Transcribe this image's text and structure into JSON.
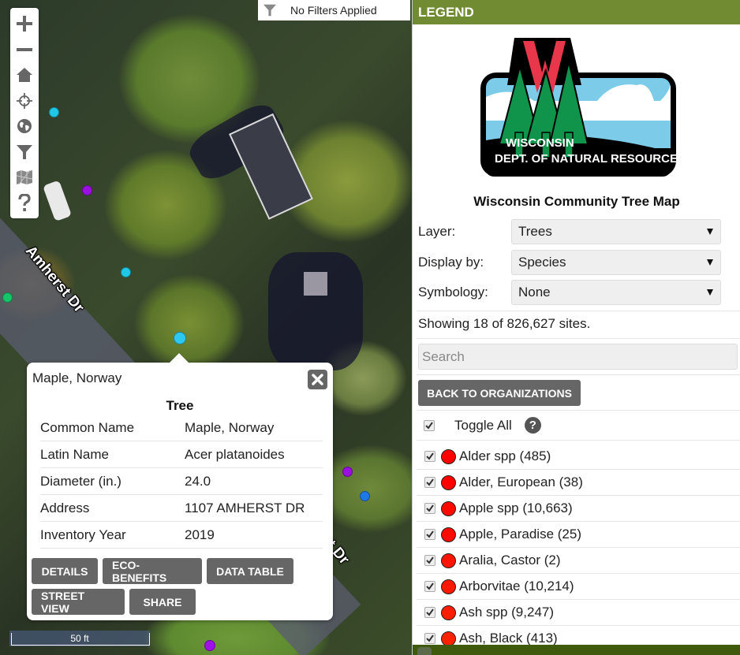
{
  "map": {
    "filter_status": "No Filters Applied",
    "road_labels": [
      "Amherst Dr",
      "rst Dr"
    ],
    "scale_label": "50 ft",
    "tools": [
      {
        "name": "zoom-in",
        "icon": "plus-icon"
      },
      {
        "name": "zoom-out",
        "icon": "minus-icon"
      },
      {
        "name": "home",
        "icon": "home-icon"
      },
      {
        "name": "locate",
        "icon": "crosshair-icon"
      },
      {
        "name": "basemap",
        "icon": "globe-icon"
      },
      {
        "name": "filter",
        "icon": "filter-icon"
      },
      {
        "name": "map-layers",
        "icon": "map-icon"
      },
      {
        "name": "help",
        "icon": "question-icon"
      }
    ],
    "tree_points": [
      {
        "color": "#1ec8e6"
      },
      {
        "color": "#9b10e0"
      },
      {
        "color": "#1ec8e6"
      },
      {
        "color": "#16c46a"
      },
      {
        "color": "#2ec8ee"
      },
      {
        "color": "#9b10e0"
      },
      {
        "color": "#1f78e8"
      },
      {
        "color": "#a010e8"
      }
    ],
    "colors": {
      "tool_icon": "#666666",
      "button_bg": "#666666"
    }
  },
  "popup": {
    "title": "Maple, Norway",
    "heading": "Tree",
    "rows": [
      {
        "label": "Common Name",
        "value": "Maple, Norway"
      },
      {
        "label": "Latin Name",
        "value": "Acer platanoides"
      },
      {
        "label": "Diameter (in.)",
        "value": "24.0"
      },
      {
        "label": "Address",
        "value": "1107 AMHERST DR"
      },
      {
        "label": "Inventory Year",
        "value": "2019"
      }
    ],
    "buttons": [
      "DETAILS",
      "ECO-BENEFITS",
      "DATA TABLE",
      "STREET VIEW",
      "SHARE"
    ]
  },
  "legend": {
    "header": "LEGEND",
    "logo": {
      "line1": "WISCONSIN",
      "line2": "DEPT. OF NATURAL RESOURCES"
    },
    "app_title": "Wisconsin Community Tree Map",
    "fields": [
      {
        "label": "Layer:",
        "value": "Trees"
      },
      {
        "label": "Display by:",
        "value": "Species"
      },
      {
        "label": "Symbology:",
        "value": "None"
      }
    ],
    "showing_text": "Showing 18 of 826,627 sites.",
    "search_placeholder": "Search",
    "back_button": "BACK TO ORGANIZATIONS",
    "toggle_all_label": "Toggle All",
    "help_glyph": "?",
    "species": [
      {
        "label": "Alder spp (485)",
        "checked": true,
        "color": "#ff0000"
      },
      {
        "label": "Alder, European (38)",
        "checked": true,
        "color": "#ff0000"
      },
      {
        "label": "Apple spp (10,663)",
        "checked": true,
        "color": "#ff0a00"
      },
      {
        "label": "Apple, Paradise (25)",
        "checked": true,
        "color": "#ff0a00"
      },
      {
        "label": "Aralia, Castor (2)",
        "checked": true,
        "color": "#ff1400"
      },
      {
        "label": "Arborvitae (10,214)",
        "checked": true,
        "color": "#ff1800"
      },
      {
        "label": "Ash spp (9,247)",
        "checked": true,
        "color": "#ff1e00"
      },
      {
        "label": "Ash, Black (413)",
        "checked": true,
        "color": "#ff2200"
      }
    ],
    "colors": {
      "header_bg": "#718b32",
      "footer_bg": "#3f5a0d"
    }
  }
}
